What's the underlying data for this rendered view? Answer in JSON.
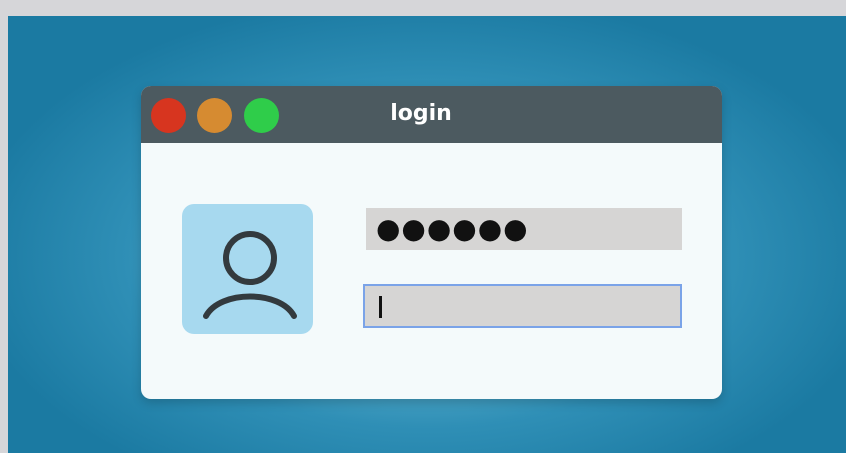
{
  "window": {
    "title": "login"
  },
  "form": {
    "password_value": "●●●●●●",
    "username_value": ""
  },
  "icons": {
    "avatar": "user-icon"
  },
  "colors": {
    "titlebar": "#4c5a60",
    "close": "#d7351f",
    "minimize": "#d68b31",
    "maximize": "#2fcd4a",
    "focus_border": "#7aa3e8",
    "avatar_bg": "#a7d9ef"
  }
}
